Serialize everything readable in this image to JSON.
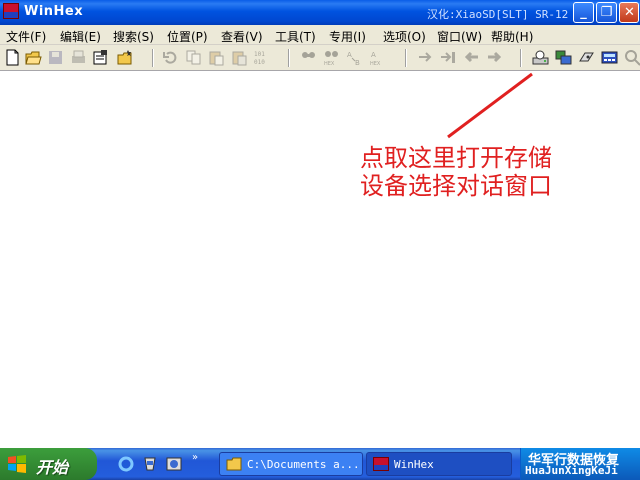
{
  "window": {
    "title": "WinHex",
    "title_right": "汉化:XiaoSD[SLT] SR-12",
    "app_icon": "winhex-icon"
  },
  "menu": [
    "文件(F)",
    "编辑(E)",
    "搜索(S)",
    "位置(P)",
    "查看(V)",
    "工具(T)",
    "专用(I)",
    "选项(O)",
    "窗口(W)",
    "帮助(H)"
  ],
  "annotation": {
    "line1": "点取这里打开存储",
    "line2": "设备选择对话窗口",
    "color": "#e02020"
  },
  "taskbar": {
    "start_label": "开始",
    "tasks": [
      {
        "label": "C:\\Documents a...",
        "icon": "folder-icon"
      },
      {
        "label": "WinHex",
        "icon": "winhex-icon"
      }
    ],
    "tray_line1": "华军行数据恢复",
    "tray_line2": "HuaJunXingKeJi"
  },
  "colors": {
    "titlebar": "#0053e0",
    "taskbar": "#245edc",
    "start": "#2c7a2c"
  }
}
